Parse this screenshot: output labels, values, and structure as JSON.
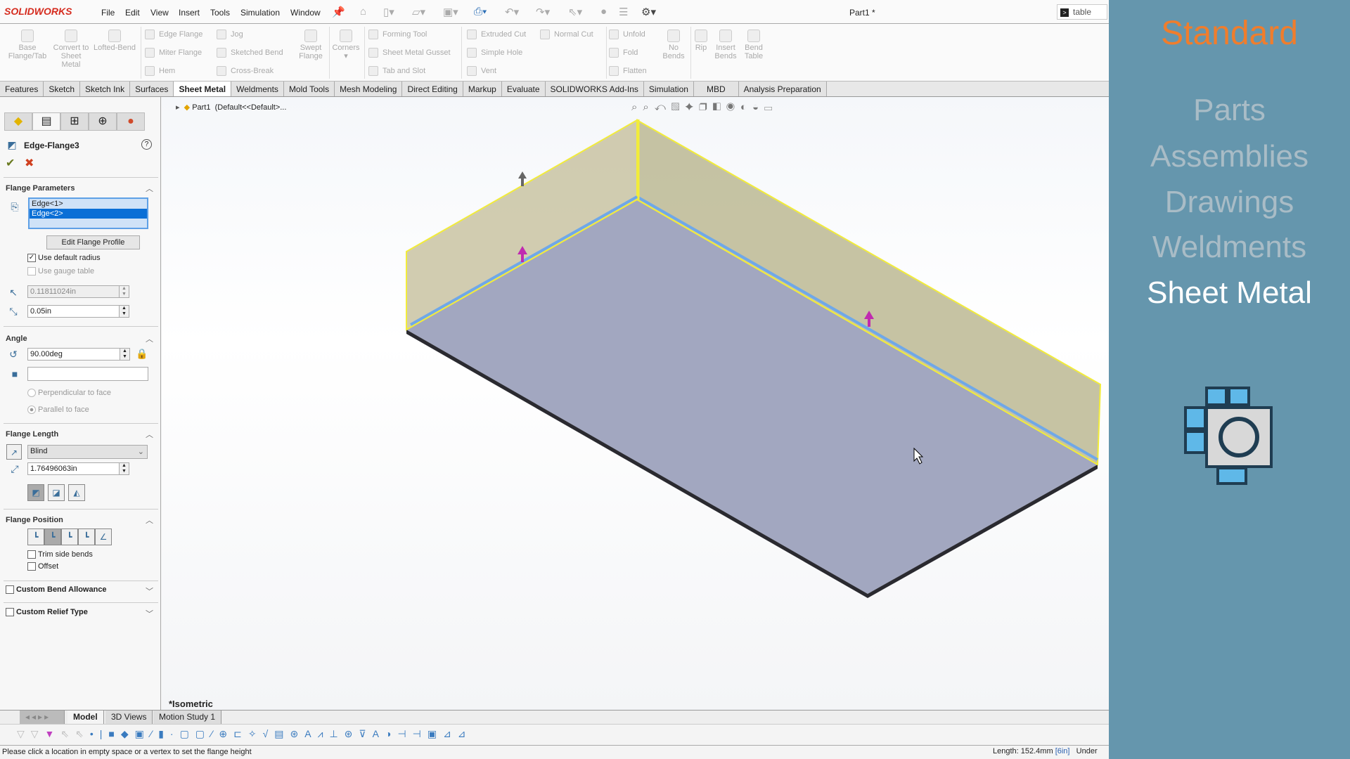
{
  "app": {
    "logo": "SOLIDWORKS",
    "menu": [
      "File",
      "Edit",
      "View",
      "Insert",
      "Tools",
      "Simulation",
      "Window"
    ],
    "document_title": "Part1 *",
    "search_value": "table"
  },
  "ribbon": {
    "large": [
      {
        "label": "Base Flange/Tab"
      },
      {
        "label": "Convert to Sheet Metal"
      },
      {
        "label": "Lofted-Bend"
      },
      {
        "label": "Swept Flange"
      },
      {
        "label": "Corners"
      },
      {
        "label": "No Bends"
      },
      {
        "label": "Rip"
      },
      {
        "label": "Insert Bends"
      },
      {
        "label": "Bend Table"
      }
    ],
    "small": [
      "Edge Flange",
      "Miter Flange",
      "Hem",
      "Jog",
      "Sketched Bend",
      "Cross-Break",
      "Forming Tool",
      "Sheet Metal Gusset",
      "Tab and Slot",
      "Extruded Cut",
      "Simple Hole",
      "Vent",
      "Normal Cut",
      "Unfold",
      "Fold",
      "Flatten"
    ]
  },
  "tabs": [
    "Features",
    "Sketch",
    "Sketch Ink",
    "Surfaces",
    "Sheet Metal",
    "Weldments",
    "Mold Tools",
    "Mesh Modeling",
    "Direct Editing",
    "Markup",
    "Evaluate",
    "SOLIDWORKS Add-Ins",
    "Simulation",
    "MBD",
    "Analysis Preparation"
  ],
  "active_tab": "Sheet Metal",
  "property_manager": {
    "title": "Edge-Flange3",
    "flange_parameters": {
      "heading": "Flange Parameters",
      "edges": [
        "Edge<1>",
        "Edge<2>"
      ],
      "selected_edge": "Edge<2>",
      "edit_profile": "Edit Flange Profile",
      "use_default_radius": {
        "label": "Use default radius",
        "checked": true
      },
      "use_gauge_table": {
        "label": "Use gauge table",
        "checked": false
      },
      "radius": "0.11811024in",
      "gap": "0.05in"
    },
    "angle": {
      "heading": "Angle",
      "value": "90.00deg",
      "face": "",
      "perpendicular": "Perpendicular to face",
      "parallel": "Parallel to face"
    },
    "flange_length": {
      "heading": "Flange Length",
      "type": "Blind",
      "value": "1.76496063in"
    },
    "flange_position": {
      "heading": "Flange Position",
      "trim_side_bends": "Trim side bends",
      "offset": "Offset"
    },
    "custom_bend_allowance": "Custom Bend Allowance",
    "custom_relief_type": "Custom Relief Type"
  },
  "viewport": {
    "tree_item": "Part1",
    "tree_config": "(Default<<Default>...",
    "view_name": "*Isometric"
  },
  "bottom_tabs": [
    "Model",
    "3D Views",
    "Motion Study 1"
  ],
  "status": {
    "message": "Please click a location in empty space or a vertex to set the flange height",
    "length_label": "Length: 152.4mm",
    "length_alt": "[6in]",
    "state": "Under"
  },
  "overlay": {
    "heading": "Standard",
    "items": [
      "Parts",
      "Assemblies",
      "Drawings",
      "Weldments",
      "Sheet Metal"
    ],
    "active": "Sheet Metal",
    "heading_color": "#f07d2c",
    "background": "#6596ad"
  }
}
